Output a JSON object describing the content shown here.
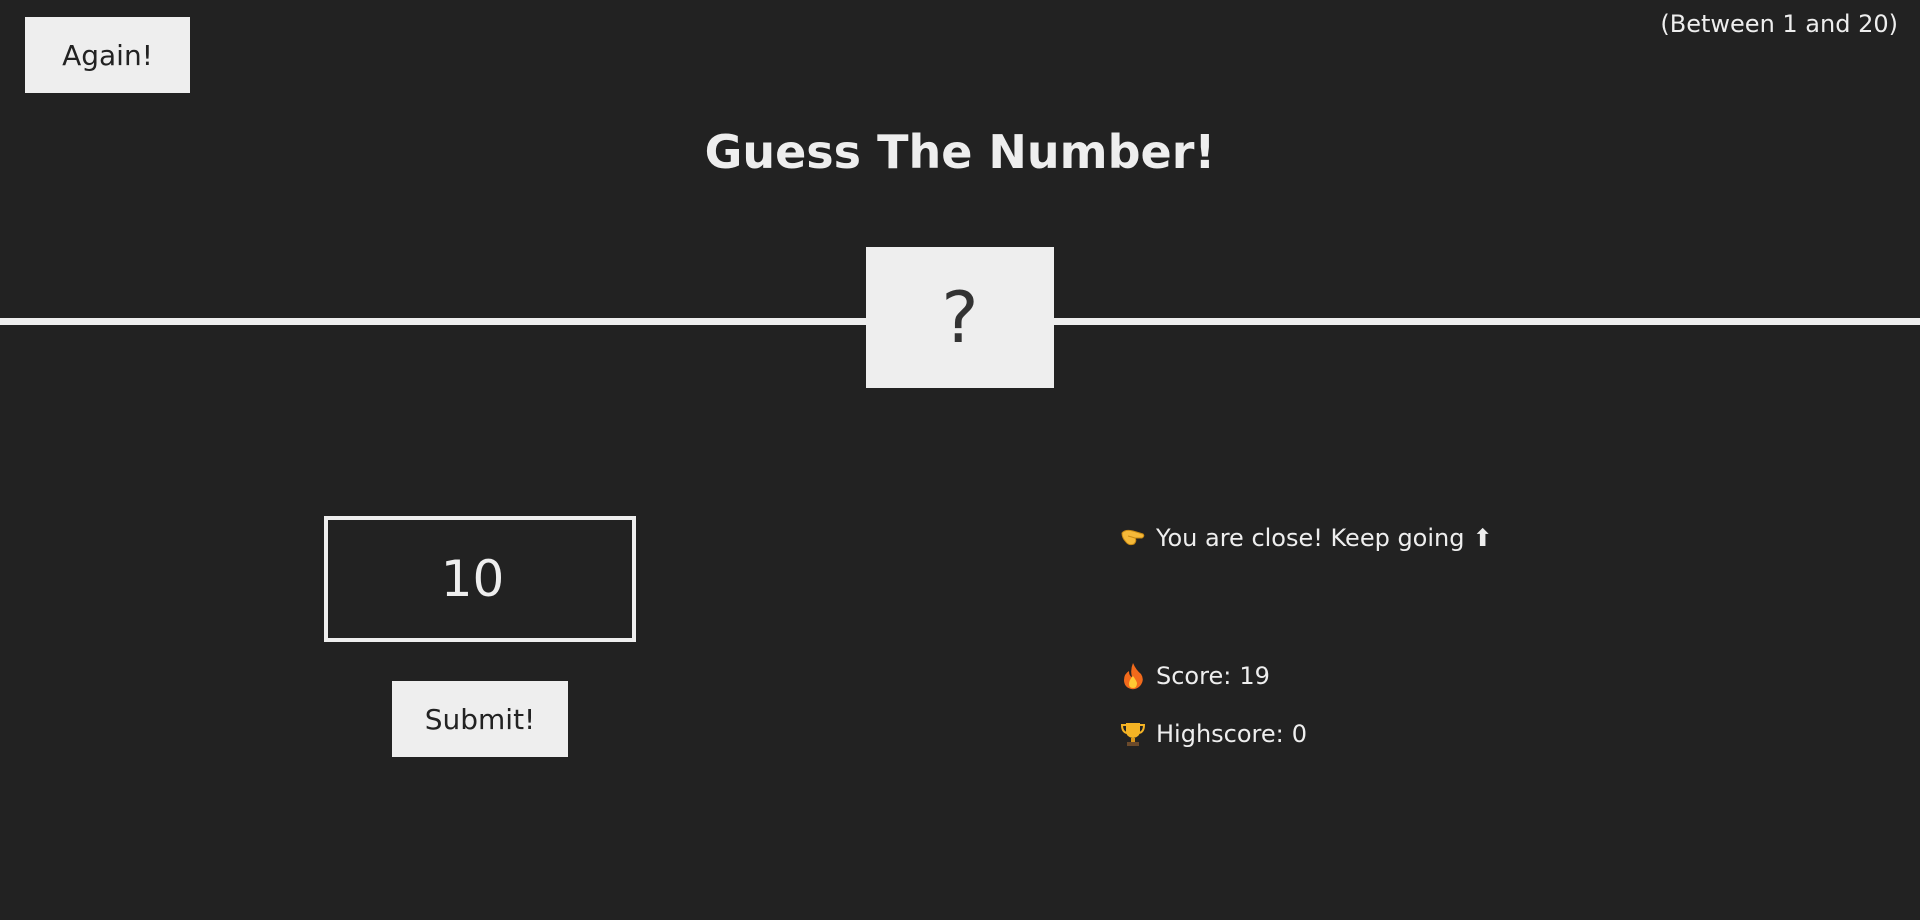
{
  "header": {
    "again_label": "Again!",
    "range_text": "(Between 1 and 20)",
    "title": "Guess The Number!"
  },
  "secret": {
    "display": "?"
  },
  "guess": {
    "value": "10"
  },
  "submit_label": "Submit!",
  "status": {
    "message": "You are close! Keep going",
    "message_icon": "pinching-hand-icon",
    "arrow": "⬆",
    "score_icon": "fire-icon",
    "score_label": "Score:",
    "score_value": "19",
    "highscore_icon": "trophy-icon",
    "highscore_label": "Highscore:",
    "highscore_value": "0"
  },
  "colors": {
    "background": "#222222",
    "foreground": "#eeeeee"
  }
}
